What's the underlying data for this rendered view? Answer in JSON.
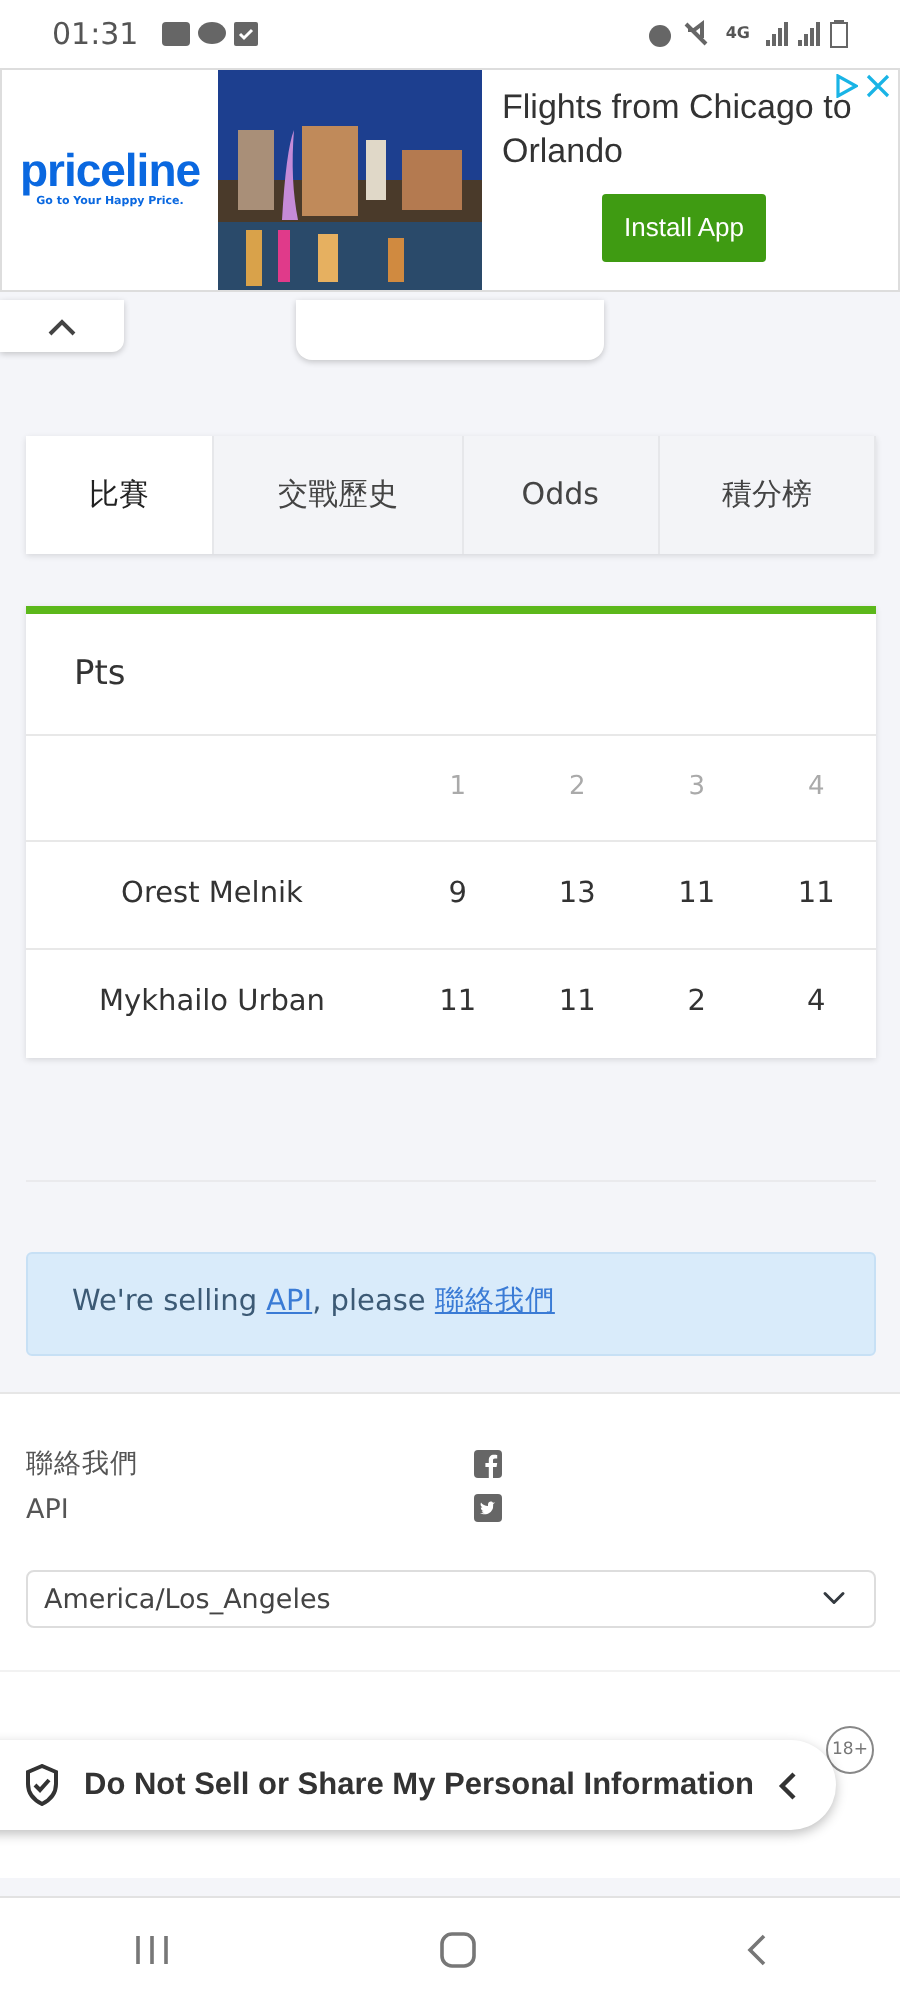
{
  "status_bar": {
    "time": "01:31",
    "network": "4G"
  },
  "ad": {
    "brand": "priceline",
    "tagline": "Go to Your Happy Price.",
    "headline": "Flights from Chicago to Orlando",
    "button": "Install App"
  },
  "tabs": [
    {
      "label": "比賽",
      "selected": true
    },
    {
      "label": "交戰歷史",
      "selected": false
    },
    {
      "label": "Odds",
      "selected": false
    },
    {
      "label": "積分榜",
      "selected": false
    }
  ],
  "score_card": {
    "title": "Pts",
    "columns": [
      "1",
      "2",
      "3",
      "4"
    ],
    "rows": [
      {
        "player": "Orest Melnik",
        "scores": [
          "9",
          "13",
          "11",
          "11"
        ]
      },
      {
        "player": "Mykhailo Urban",
        "scores": [
          "11",
          "11",
          "2",
          "4"
        ]
      }
    ]
  },
  "notice": {
    "text": "We're selling ",
    "link1": "API",
    "middle": ", please ",
    "link2": "聯絡我們"
  },
  "footer": {
    "links": [
      "聯絡我們",
      "API"
    ],
    "timezone": "America/Los_Angeles",
    "age_badge": "18+"
  },
  "privacy_banner": {
    "label": "Do Not Sell or Share My Personal Information"
  }
}
